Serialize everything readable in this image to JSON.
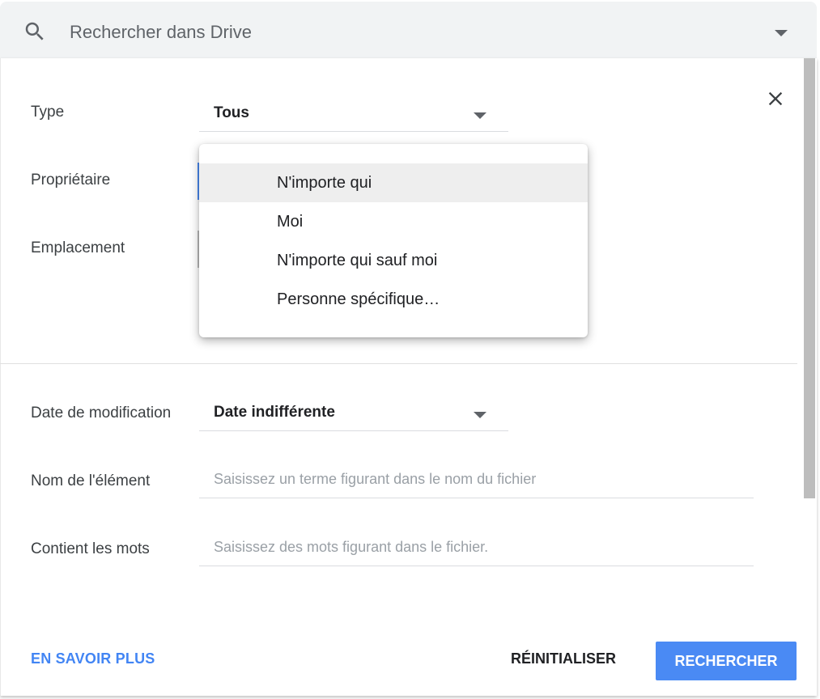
{
  "search": {
    "placeholder": "Rechercher dans Drive",
    "icon": "search-icon"
  },
  "filters": {
    "type": {
      "label": "Type",
      "value": "Tous"
    },
    "owner": {
      "label": "Propriétaire"
    },
    "location": {
      "label": "Emplacement"
    },
    "modified": {
      "label": "Date de modification",
      "value": "Date indifférente"
    },
    "item_name": {
      "label": "Nom de l'élément",
      "placeholder": "Saisissez un terme figurant dans le nom du fichier"
    },
    "contains": {
      "label": "Contient les mots",
      "placeholder": "Saisissez des mots figurant dans le fichier."
    }
  },
  "owner_dropdown": {
    "options": [
      "N'importe qui",
      "Moi",
      "N'importe qui sauf moi",
      "Personne spécifique…"
    ],
    "highlighted_index": 0
  },
  "footer": {
    "learn_more": "EN SAVOIR PLUS",
    "reset": "RÉINITIALISER",
    "search": "RECHERCHER"
  },
  "colors": {
    "accent": "#4a8af4",
    "link": "#4285f4",
    "search_bar_bg": "#f1f3f4"
  }
}
